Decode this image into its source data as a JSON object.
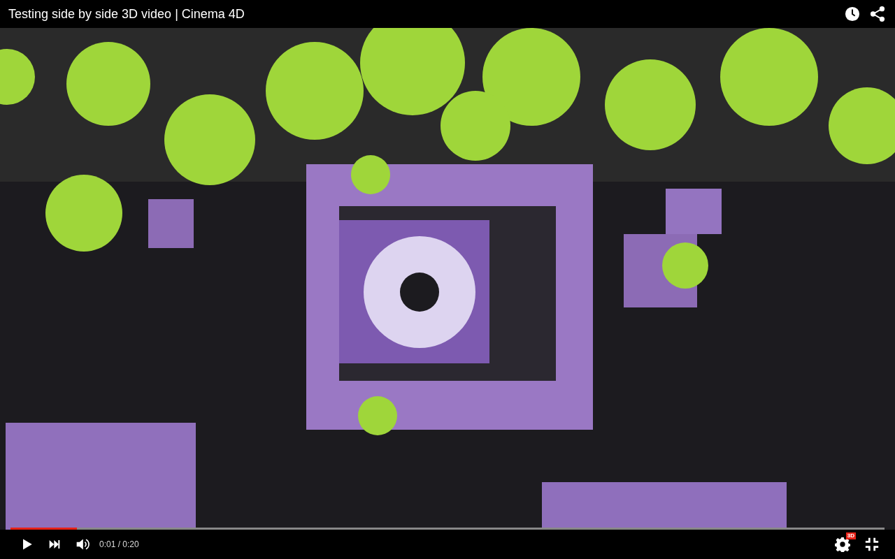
{
  "title_bar": {
    "title": "Testing side by side 3D video | Cinema 4D"
  },
  "progress": {
    "level": 0.076
  },
  "controls": {
    "time": "0:01 / 0:20",
    "settings_badge": "3D"
  }
}
